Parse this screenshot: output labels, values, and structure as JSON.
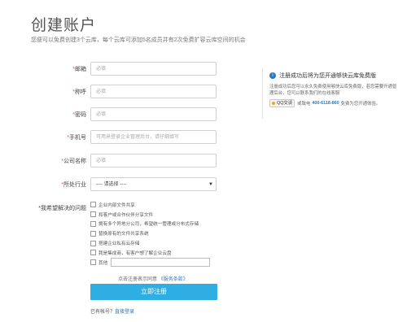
{
  "header": {
    "title": "创建账户",
    "subtitle": "您便可以免费创建3个云库，每个云库可添加5名成员并有2次免费扩容云库空间的机会"
  },
  "form": {
    "fields": [
      {
        "label": "邮箱",
        "placeholder": "必填",
        "required": true
      },
      {
        "label": "称呼",
        "placeholder": "必填",
        "required": true
      },
      {
        "label": "密码",
        "placeholder": "必填",
        "required": true
      },
      {
        "label": "手机号",
        "placeholder": "可用来登录企业管理后台，请仔细填写",
        "required": true
      },
      {
        "label": "公司名称",
        "placeholder": "必填",
        "required": true
      },
      {
        "label": "所处行业",
        "placeholder": "---- 请选择 ----",
        "required": true
      }
    ],
    "question_label": "*我希望解决的问题",
    "options": [
      "企业内部文件共享",
      "和客户或合作伙伴分享文件",
      "拥有多个异地分公司，希望统一管理或分布式存储",
      "替换原有的文件共享系统",
      "搭建企业私有云存储",
      "我是集成商，有客户想了解企业云盘",
      "其他"
    ],
    "agree_text": "点击注册表示同意",
    "agree_link": "《服务条款》",
    "submit_label": "立即注册",
    "login_text": "已有帐号？",
    "login_link": "直接登录"
  },
  "side": {
    "title": "注册成功后将为您开通够快云库免费版",
    "text": "注册成功后您可以永久免费使用够快云库免费版，若您需要开通管理后台，您可以联系我们的在线客服",
    "qq_label": "QQ交谈",
    "or_call": "或致电",
    "phone": "400-6118-860",
    "tail": "免费为您开通体验。"
  }
}
